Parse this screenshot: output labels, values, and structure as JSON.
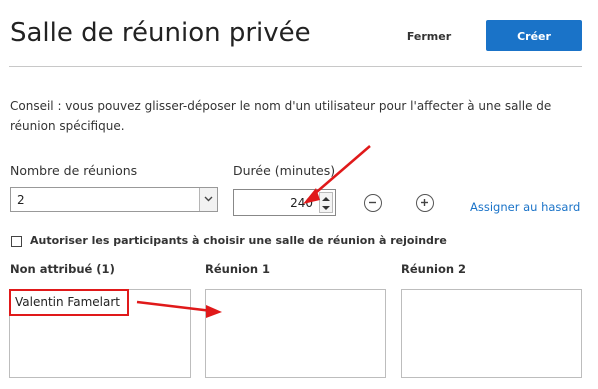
{
  "header": {
    "title": "Salle de réunion privée",
    "close_label": "Fermer",
    "create_label": "Créer"
  },
  "tip": "Conseil : vous pouvez glisser-déposer le nom d'un utilisateur pour l'affecter à une salle de réunion spécifique.",
  "form": {
    "rooms_count_label": "Nombre de réunions",
    "rooms_count_value": "2",
    "duration_label": "Durée (minutes)",
    "duration_value": "240",
    "random_assign_label": "Assigner au hasard",
    "allow_choose_label": "Autoriser les participants à choisir une salle de réunion à rejoindre",
    "allow_choose_checked": false
  },
  "columns": [
    {
      "header": "Non attribué (1)",
      "users": [
        "Valentin Famelart"
      ]
    },
    {
      "header": "Réunion 1",
      "users": []
    },
    {
      "header": "Réunion 2",
      "users": []
    }
  ],
  "colors": {
    "accent": "#1a73c8",
    "annotation": "#e0191a"
  },
  "icons": [
    "chevron-down-icon",
    "spinner-up-icon",
    "spinner-down-icon",
    "minus-circle-icon",
    "plus-circle-icon"
  ]
}
